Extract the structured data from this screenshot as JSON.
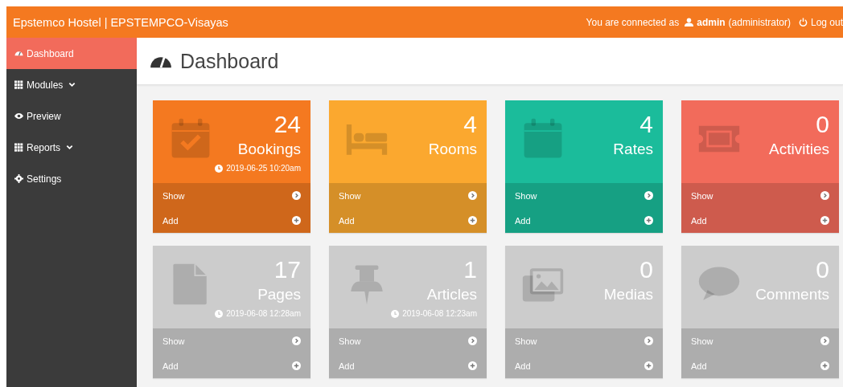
{
  "topbar": {
    "title": "Epstemco Hostel | EPSTEMPCO-Visayas",
    "connected_label": "You are connected as",
    "user": "admin",
    "role": "(administrator)",
    "logout": "Log out"
  },
  "sidebar": {
    "items": [
      {
        "label": "Dashboard",
        "kind": "gauge",
        "selected": true,
        "dropdown": false
      },
      {
        "label": "Modules",
        "kind": "grid",
        "selected": false,
        "dropdown": true
      },
      {
        "label": "Preview",
        "kind": "eye",
        "selected": false,
        "dropdown": false
      },
      {
        "label": "Reports",
        "kind": "grid",
        "selected": false,
        "dropdown": true
      },
      {
        "label": "Settings",
        "kind": "gear",
        "selected": false,
        "dropdown": false
      }
    ]
  },
  "page": {
    "title": "Dashboard"
  },
  "cards": [
    {
      "count": "24",
      "label": "Bookings",
      "kind": "calendar-check",
      "color": "#f47920",
      "timestamp": "2019-06-25 10:20am",
      "show": "Show",
      "add": "Add"
    },
    {
      "count": "4",
      "label": "Rooms",
      "kind": "bed",
      "color": "#fba82f",
      "show": "Show",
      "add": "Add"
    },
    {
      "count": "4",
      "label": "Rates",
      "kind": "calendar",
      "color": "#1bbc9b",
      "show": "Show",
      "add": "Add"
    },
    {
      "count": "0",
      "label": "Activities",
      "kind": "ticket",
      "color": "#f26b5b",
      "show": "Show",
      "add": "Add"
    },
    {
      "count": "17",
      "label": "Pages",
      "kind": "file",
      "color": "#cccccc",
      "timestamp": "2019-06-08 12:28am",
      "show": "Show",
      "add": "Add"
    },
    {
      "count": "1",
      "label": "Articles",
      "kind": "pin",
      "color": "#cccccc",
      "timestamp": "2019-06-08 12:23am",
      "show": "Show",
      "add": "Add"
    },
    {
      "count": "0",
      "label": "Medias",
      "kind": "images",
      "color": "#cccccc",
      "show": "Show",
      "add": "Add"
    },
    {
      "count": "0",
      "label": "Comments",
      "kind": "comment",
      "color": "#cccccc",
      "show": "Show",
      "add": "Add"
    }
  ]
}
